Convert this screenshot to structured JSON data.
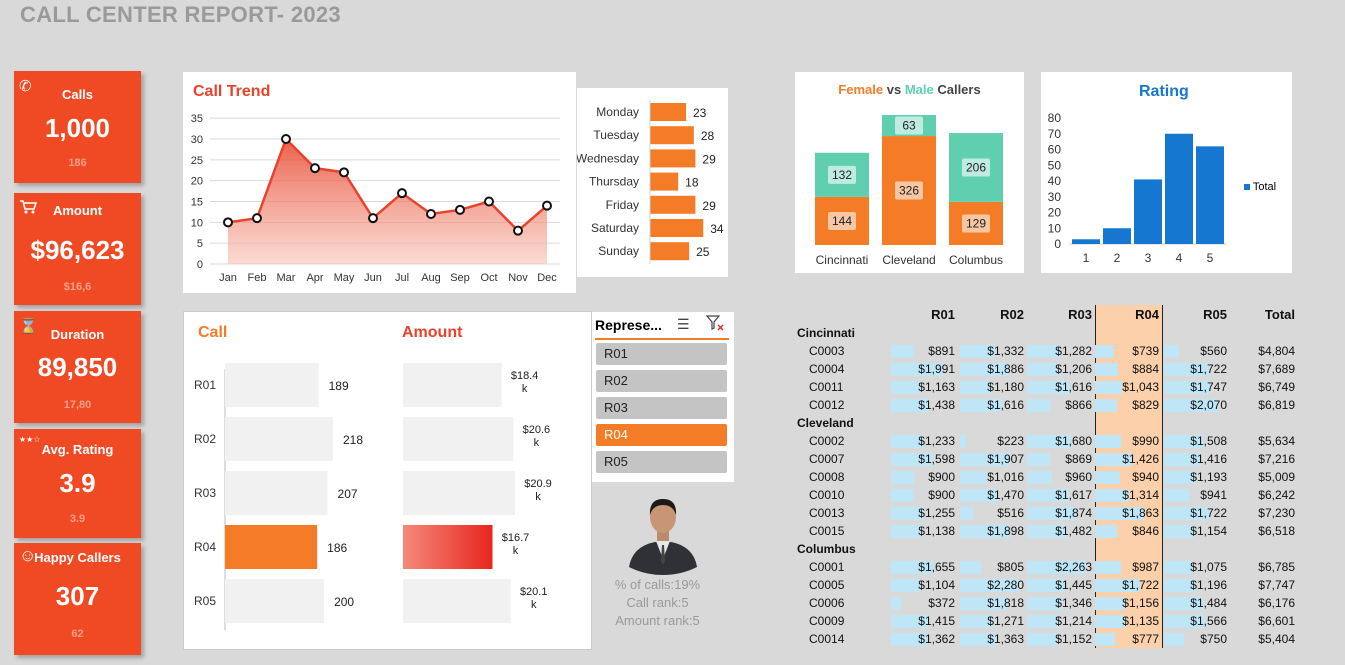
{
  "title": "CALL CENTER REPORT- 2023",
  "kpis": [
    {
      "label": "Calls",
      "value": "1,000",
      "sub": "186",
      "icon": "phone-icon"
    },
    {
      "label": "Amount",
      "value": "$96,623",
      "sub": "$16,6",
      "icon": "cart-icon"
    },
    {
      "label": "Duration",
      "value": "89,850",
      "sub": "17,80",
      "icon": "hourglass-icon"
    },
    {
      "label": "Avg. Rating",
      "value": "3.9",
      "sub": "3.9",
      "icon": "stars-icon"
    },
    {
      "label": "Happy Callers",
      "value": "307",
      "sub": "62",
      "icon": "smiley-icon"
    }
  ],
  "call_trend": {
    "title": "Call Trend",
    "chart_data": {
      "type": "area",
      "categories": [
        "Jan",
        "Feb",
        "Mar",
        "Apr",
        "May",
        "Jun",
        "Jul",
        "Aug",
        "Sep",
        "Oct",
        "Nov",
        "Dec"
      ],
      "values": [
        10,
        11,
        30,
        23,
        22,
        11,
        17,
        12,
        13,
        15,
        8,
        14
      ],
      "ylim": [
        0,
        35
      ],
      "yticks": [
        "0",
        "5",
        "10",
        "15",
        "20",
        "25",
        "30",
        "35"
      ],
      "color": "#e8432a"
    }
  },
  "weekday": {
    "chart_data": {
      "type": "bar",
      "categories": [
        "Monday",
        "Tuesday",
        "Wednesday",
        "Thursday",
        "Friday",
        "Saturday",
        "Sunday"
      ],
      "values": [
        23,
        28,
        29,
        18,
        29,
        34,
        25
      ],
      "color": "#f57c26"
    }
  },
  "gender": {
    "title_female": "Female",
    "title_vs": "vs",
    "title_male": "Male",
    "title_callers": "Callers",
    "chart_data": {
      "type": "bar",
      "stacked": true,
      "categories": [
        "Cincinnati",
        "Cleveland",
        "Columbus"
      ],
      "series": [
        {
          "name": "Female",
          "values": [
            144,
            326,
            129
          ],
          "color": "#f57c26"
        },
        {
          "name": "Male",
          "values": [
            132,
            63,
            206
          ],
          "color": "#5fcfb0"
        }
      ]
    }
  },
  "rating": {
    "title": "Rating",
    "legend": "Total",
    "chart_data": {
      "type": "bar",
      "categories": [
        "1",
        "2",
        "3",
        "4",
        "5"
      ],
      "values": [
        3,
        10,
        41,
        70,
        62
      ],
      "ylim": [
        0,
        80
      ],
      "yticks": [
        "0",
        "10",
        "20",
        "30",
        "40",
        "50",
        "60",
        "70",
        "80"
      ],
      "color": "#1577d0"
    }
  },
  "rep_calls": {
    "title": "Call",
    "chart_data": {
      "type": "bar",
      "categories": [
        "R01",
        "R02",
        "R03",
        "R04",
        "R05"
      ],
      "values": [
        189,
        218,
        207,
        186,
        200
      ],
      "labels": [
        "189",
        "218",
        "207",
        "186",
        "200"
      ],
      "highlight": "R04"
    }
  },
  "rep_amount": {
    "title": "Amount",
    "chart_data": {
      "type": "bar",
      "categories": [
        "R01",
        "R02",
        "R03",
        "R04",
        "R05"
      ],
      "values": [
        18.4,
        20.6,
        20.9,
        16.7,
        20.1
      ],
      "labels_top": [
        "$18.4",
        "$20.6",
        "$20.9",
        "$16.7",
        "$20.1"
      ],
      "labels_bottom": [
        "k",
        "k",
        "k",
        "k",
        "k"
      ],
      "highlight": "R04"
    }
  },
  "slicer": {
    "header": "Represe...",
    "items": [
      "R01",
      "R02",
      "R03",
      "R04",
      "R05"
    ],
    "selected": "R04"
  },
  "profile": {
    "line1": "% of calls:19%",
    "line2": "Call rank:5",
    "line3": "Amount rank:5"
  },
  "table": {
    "headers": [
      "R01",
      "R02",
      "R03",
      "R04",
      "R05",
      "Total"
    ],
    "groups": [
      {
        "name": "Cincinnati",
        "rows": [
          {
            "id": "C0003",
            "vals": [
              "$891",
              "$1,332",
              "$1,282",
              "$739",
              "$560"
            ],
            "nums": [
              891,
              1332,
              1282,
              739,
              560
            ],
            "total": "$4,804"
          },
          {
            "id": "C0004",
            "vals": [
              "$1,991",
              "$1,886",
              "$1,206",
              "$884",
              "$1,722"
            ],
            "nums": [
              1991,
              1886,
              1206,
              884,
              1722
            ],
            "total": "$7,689"
          },
          {
            "id": "C0011",
            "vals": [
              "$1,163",
              "$1,180",
              "$1,616",
              "$1,043",
              "$1,747"
            ],
            "nums": [
              1163,
              1180,
              1616,
              1043,
              1747
            ],
            "total": "$6,749"
          },
          {
            "id": "C0012",
            "vals": [
              "$1,438",
              "$1,616",
              "$866",
              "$829",
              "$2,070"
            ],
            "nums": [
              1438,
              1616,
              866,
              829,
              2070
            ],
            "total": "$6,819"
          }
        ]
      },
      {
        "name": "Cleveland",
        "rows": [
          {
            "id": "C0002",
            "vals": [
              "$1,233",
              "$223",
              "$1,680",
              "$990",
              "$1,508"
            ],
            "nums": [
              1233,
              223,
              1680,
              990,
              1508
            ],
            "total": "$5,634"
          },
          {
            "id": "C0007",
            "vals": [
              "$1,598",
              "$1,907",
              "$869",
              "$1,426",
              "$1,416"
            ],
            "nums": [
              1598,
              1907,
              869,
              1426,
              1416
            ],
            "total": "$7,216"
          },
          {
            "id": "C0008",
            "vals": [
              "$900",
              "$1,016",
              "$960",
              "$940",
              "$1,193"
            ],
            "nums": [
              900,
              1016,
              960,
              940,
              1193
            ],
            "total": "$5,009"
          },
          {
            "id": "C0010",
            "vals": [
              "$900",
              "$1,470",
              "$1,617",
              "$1,314",
              "$941"
            ],
            "nums": [
              900,
              1470,
              1617,
              1314,
              941
            ],
            "total": "$6,242"
          },
          {
            "id": "C0013",
            "vals": [
              "$1,255",
              "$516",
              "$1,874",
              "$1,863",
              "$1,722"
            ],
            "nums": [
              1255,
              516,
              1874,
              1863,
              1722
            ],
            "total": "$7,230"
          },
          {
            "id": "C0015",
            "vals": [
              "$1,138",
              "$1,898",
              "$1,482",
              "$846",
              "$1,154"
            ],
            "nums": [
              1138,
              1898,
              1482,
              846,
              1154
            ],
            "total": "$6,518"
          }
        ]
      },
      {
        "name": "Columbus",
        "rows": [
          {
            "id": "C0001",
            "vals": [
              "$1,655",
              "$805",
              "$2,263",
              "$987",
              "$1,075"
            ],
            "nums": [
              1655,
              805,
              2263,
              987,
              1075
            ],
            "total": "$6,785"
          },
          {
            "id": "C0005",
            "vals": [
              "$1,104",
              "$2,280",
              "$1,445",
              "$1,722",
              "$1,196"
            ],
            "nums": [
              1104,
              2280,
              1445,
              1722,
              1196
            ],
            "total": "$7,747"
          },
          {
            "id": "C0006",
            "vals": [
              "$372",
              "$1,818",
              "$1,346",
              "$1,156",
              "$1,484"
            ],
            "nums": [
              372,
              1818,
              1346,
              1156,
              1484
            ],
            "total": "$6,176"
          },
          {
            "id": "C0009",
            "vals": [
              "$1,415",
              "$1,271",
              "$1,214",
              "$1,135",
              "$1,566"
            ],
            "nums": [
              1415,
              1271,
              1214,
              1135,
              1566
            ],
            "total": "$6,601"
          },
          {
            "id": "C0014",
            "vals": [
              "$1,362",
              "$1,363",
              "$1,152",
              "$777",
              "$750"
            ],
            "nums": [
              1362,
              1363,
              1152,
              777,
              750
            ],
            "total": "$5,404"
          }
        ]
      }
    ]
  }
}
